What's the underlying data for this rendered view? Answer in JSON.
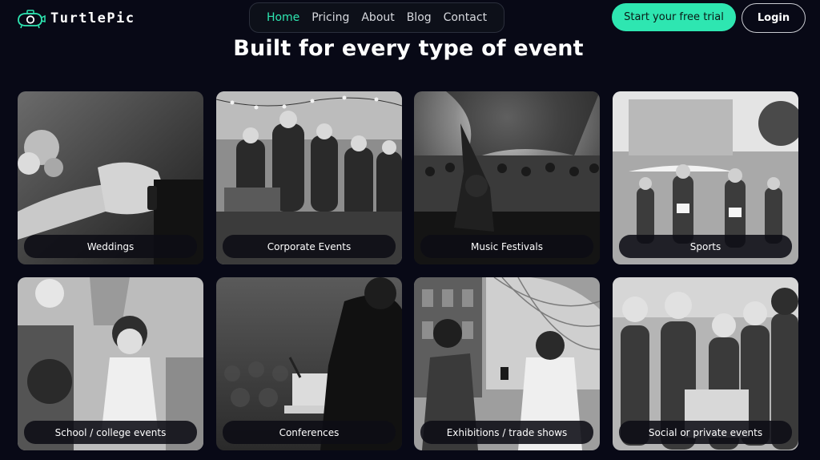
{
  "brand": {
    "name": "TurtlePic",
    "logo_icon": "turtle-camera-icon"
  },
  "nav": {
    "items": [
      {
        "label": "Home",
        "active": true
      },
      {
        "label": "Pricing",
        "active": false
      },
      {
        "label": "About",
        "active": false
      },
      {
        "label": "Blog",
        "active": false
      },
      {
        "label": "Contact",
        "active": false
      }
    ]
  },
  "cta": {
    "trial_label": "Start your free trial",
    "login_label": "Login"
  },
  "section": {
    "heading": "Built for every type of event",
    "cards": [
      {
        "label": "Weddings"
      },
      {
        "label": "Corporate Events"
      },
      {
        "label": "Music Festivals"
      },
      {
        "label": "Sports"
      },
      {
        "label": "School / college events"
      },
      {
        "label": "Conferences"
      },
      {
        "label": "Exhibitions / trade shows"
      },
      {
        "label": "Social or private events"
      }
    ]
  },
  "colors": {
    "background": "#080916",
    "accent": "#2ee6b1",
    "text": "#ffffff"
  }
}
